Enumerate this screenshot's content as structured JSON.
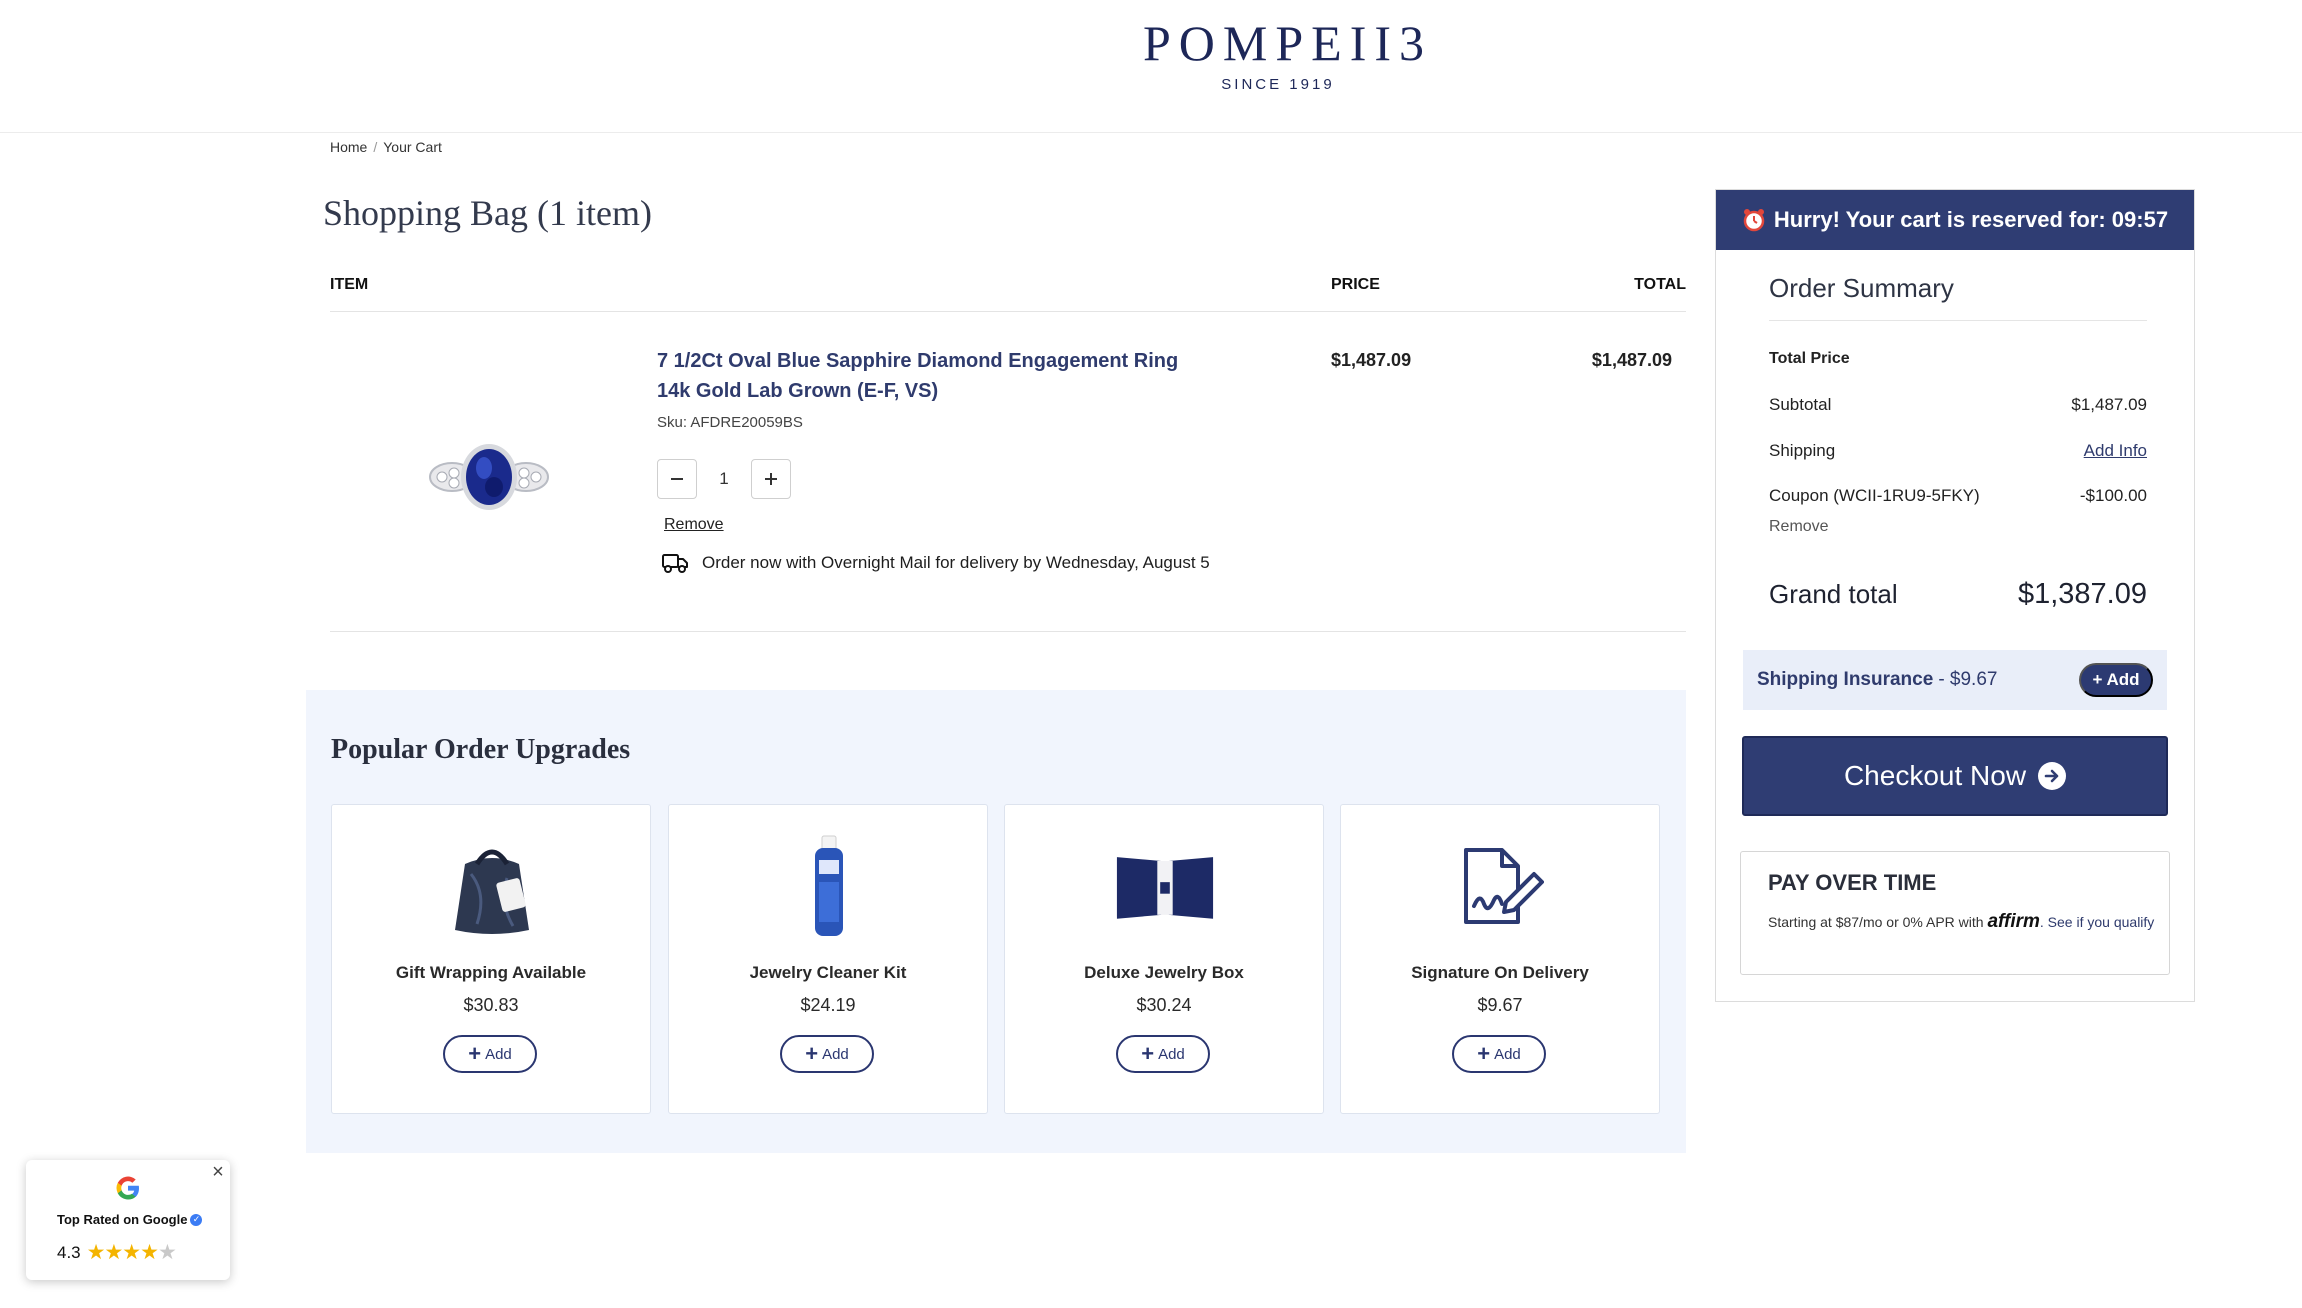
{
  "brand": {
    "name": "POMPEII3",
    "tagline": "SINCE 1919",
    "accent": "#2f3d73"
  },
  "breadcrumb": {
    "home": "Home",
    "separator": "/",
    "current": "Your Cart"
  },
  "page_title": "Shopping Bag (1 item)",
  "cart": {
    "headers": {
      "item": "ITEM",
      "price": "PRICE",
      "total": "TOTAL"
    },
    "item": {
      "name": "7 1/2Ct Oval Blue Sapphire Diamond Engagement Ring 14k Gold Lab Grown (E-F, VS)",
      "sku": "Sku: AFDRE20059BS",
      "quantity": "1",
      "remove_label": "Remove",
      "delivery": "Order now with Overnight Mail for delivery by Wednesday, August 5",
      "price": "$1,487.09",
      "total": "$1,487.09"
    }
  },
  "upgrades": {
    "title": "Popular Order Upgrades",
    "add_label": "Add",
    "items": [
      {
        "name": "Gift Wrapping Available",
        "price": "$30.83",
        "icon": "gift-bag-icon"
      },
      {
        "name": "Jewelry Cleaner Kit",
        "price": "$24.19",
        "icon": "cleaner-bottle-icon"
      },
      {
        "name": "Deluxe Jewelry Box",
        "price": "$30.24",
        "icon": "jewelry-box-icon"
      },
      {
        "name": "Signature On Delivery",
        "price": "$9.67",
        "icon": "signature-icon"
      }
    ]
  },
  "summary": {
    "timer_text": "Hurry! Your cart is reserved for: 09:57",
    "title": "Order Summary",
    "total_price_label": "Total Price",
    "subtotal_label": "Subtotal",
    "subtotal_value": "$1,487.09",
    "shipping_label": "Shipping",
    "shipping_value": "Add Info",
    "coupon_label": "Coupon (WCII-1RU9-5FKY)",
    "coupon_value": "-$100.00",
    "coupon_remove": "Remove",
    "grand_total_label": "Grand total",
    "grand_total_value": "$1,387.09",
    "insurance_label": "Shipping Insurance",
    "insurance_price": "- $9.67",
    "insurance_add": "Add",
    "checkout_label": "Checkout Now",
    "pay_title": "PAY OVER TIME",
    "pay_text_1": "Starting at $87/mo or 0% APR with",
    "pay_brand": "affirm",
    "pay_text_2": ". See if you qualify"
  },
  "google_badge": {
    "label": "Top Rated on Google",
    "rating": "4.3",
    "stars_filled": 4.3,
    "stars_max": 5
  }
}
